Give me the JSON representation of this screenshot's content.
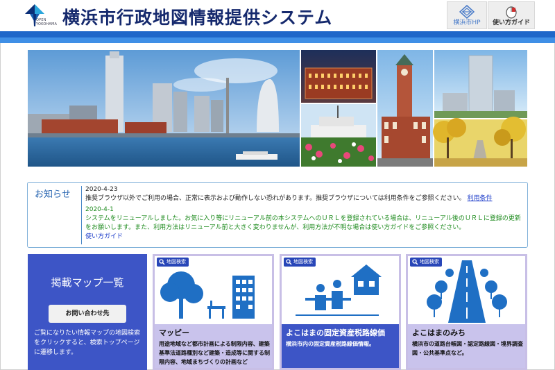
{
  "header": {
    "logo_text_line1": "OPEN",
    "logo_text_line2": "YOKOHAMA",
    "title": "横浜市行政地図情報提供システム",
    "hp_button_label": "横浜市HP",
    "guide_button_label": "使い方ガイド"
  },
  "news": {
    "title": "お知らせ",
    "items": [
      {
        "date": "2020-4-23",
        "text": "推奨ブラウザ以外でご利用の場合、正常に表示および動作しない恐れがあります。推奨ブラウザについては利用条件をご参照ください。",
        "link": "利用条件"
      },
      {
        "date": "2020-4-1",
        "text": "システムをリニューアルしました。お気に入り等にリニューアル前の本システムへのＵＲＬを登録されている場合は、リニューアル後のＵＲＬに登録の更新をお願いします。また、利用方法はリニューアル前と大きく変わりませんが、利用方法が不明な場合は使い方ガイドをご参照ください。",
        "link": "使い方ガイド"
      }
    ]
  },
  "side_panel": {
    "title": "掲載マップ一覧",
    "contact_button": "お問い合わせ先",
    "description": "ご覧になりたい情報マップの地図検索をクリックすると、検索トップページに遷移します。"
  },
  "cards": [
    {
      "tag": "地図検索",
      "title": "マッピー",
      "description": "用途地域など都市計画による制限内容、建築基準法道路種別など建築・造成等に関する制限内容、地域まちづくりの計画など"
    },
    {
      "tag": "地図検索",
      "title": "よこはまの固定資産税路線価",
      "description": "横浜市内の固定資産税路線価情報。"
    },
    {
      "tag": "地図検索",
      "title": "よこはまのみち",
      "description": "横浜市の道路台帳図・認定路線図・境界調査図・公共基準点など。"
    }
  ],
  "colors": {
    "title": "#15296d",
    "header_bar": "#1f67c9",
    "panel_blue": "#3d55c6",
    "panel_lavender": "#c9c3ec",
    "news_green": "#1c8a1c",
    "link_blue": "#1a3ac9"
  }
}
